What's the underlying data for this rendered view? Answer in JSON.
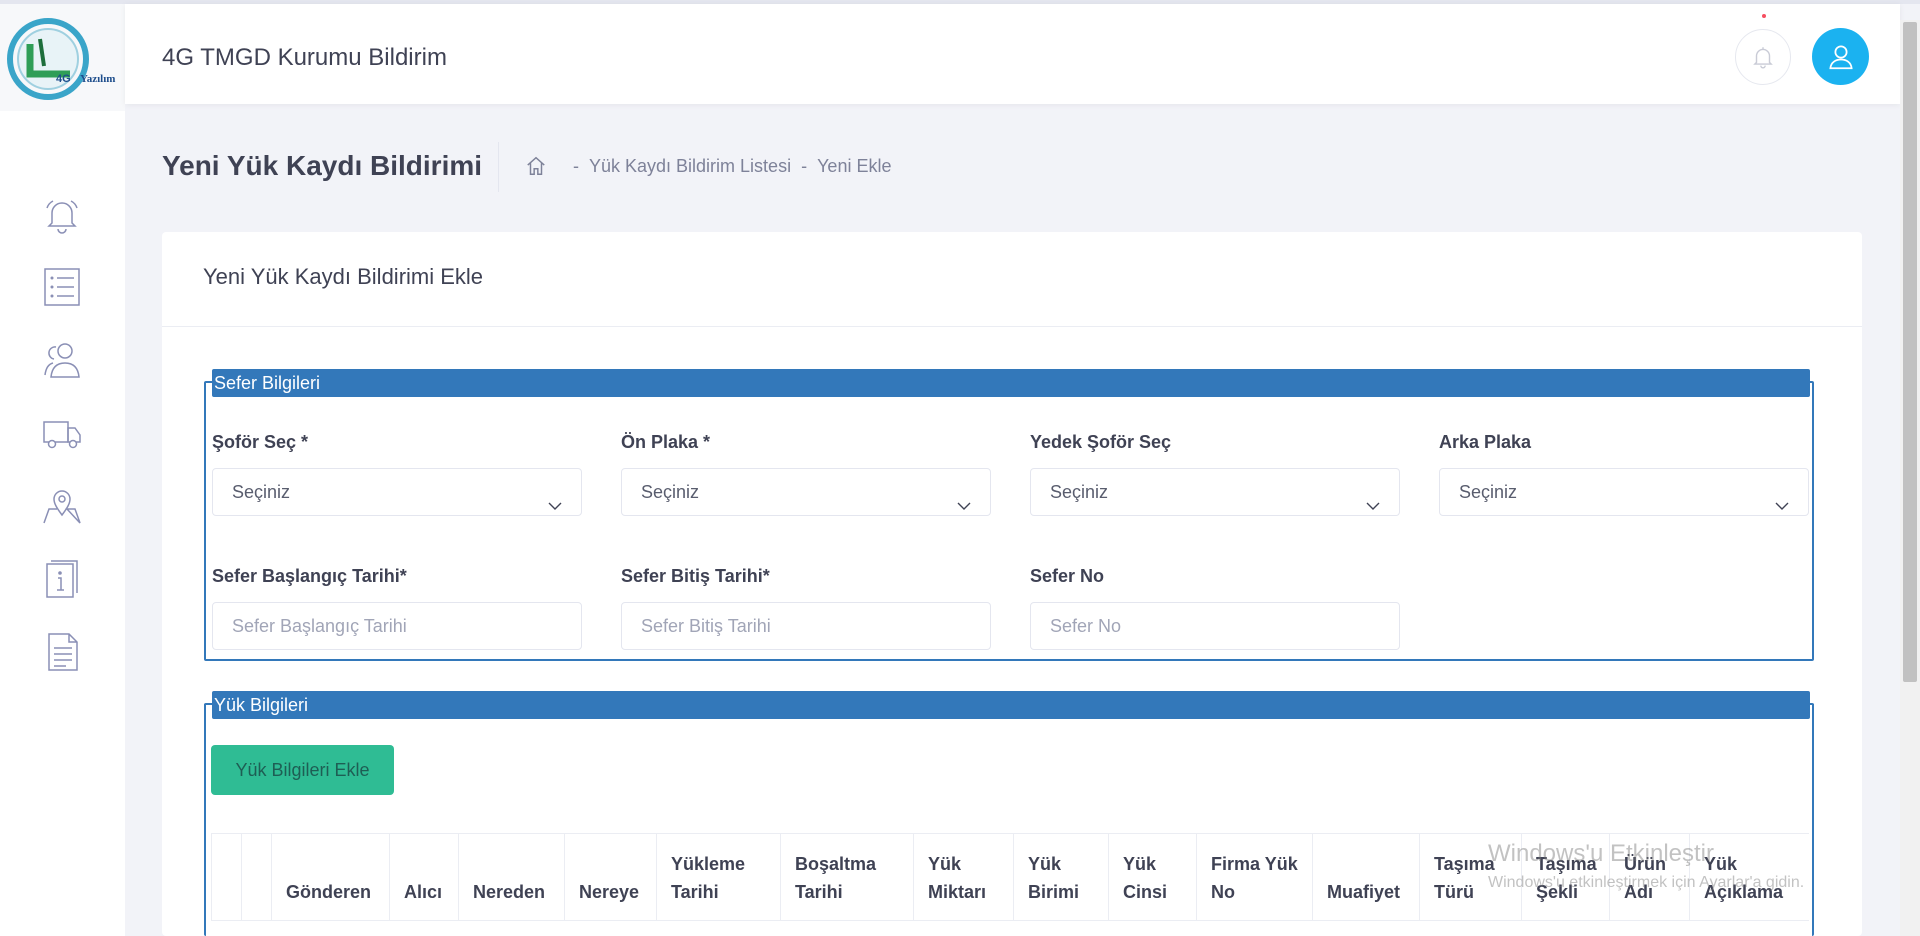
{
  "header": {
    "app_title": "4G TMGD Kurumu Bildirim",
    "logo_text": "4G Yazılım"
  },
  "sidebar": {
    "icons": [
      "bell-icon",
      "list-icon",
      "users-icon",
      "truck-icon",
      "map-pin-icon",
      "info-book-icon",
      "document-icon"
    ]
  },
  "page": {
    "title": "Yeni Yük Kaydı Bildirimi",
    "breadcrumb": [
      "-",
      "Yük Kaydı Bildirim Listesi",
      "-",
      "Yeni Ekle"
    ]
  },
  "card": {
    "title": "Yeni Yük Kaydı Bildirimi Ekle",
    "sefer": {
      "legend": "Sefer Bilgileri",
      "sofor_label": "Şoför Seç *",
      "sofor_value": "Seçiniz",
      "on_plaka_label": "Ön Plaka *",
      "on_plaka_value": "Seçiniz",
      "yedek_sofor_label": "Yedek Şoför Seç",
      "yedek_sofor_value": "Seçiniz",
      "arka_plaka_label": "Arka Plaka",
      "arka_plaka_value": "Seçiniz",
      "baslangic_label": "Sefer Başlangıç Tarihi*",
      "baslangic_placeholder": "Sefer Başlangıç Tarihi",
      "bitis_label": "Sefer Bitiş Tarihi*",
      "bitis_placeholder": "Sefer Bitiş Tarihi",
      "sefer_no_label": "Sefer No",
      "sefer_no_placeholder": "Sefer No"
    },
    "yuk": {
      "legend": "Yük Bilgileri",
      "add_button": "Yük Bilgileri Ekle",
      "columns": [
        "",
        "",
        "Gönderen",
        "Alıcı",
        "Nereden",
        "Nereye",
        "Yükleme Tarihi",
        "Boşaltma Tarihi",
        "Yük Miktarı",
        "Yük Birimi",
        "Yük Cinsi",
        "Firma Yük No",
        "Muafiyet",
        "Taşıma Türü",
        "Taşıma Şekli",
        "Ürün Adı",
        "Yük Açıklama"
      ]
    }
  },
  "watermark": {
    "line1": "Windows'u Etkinleştir",
    "line2": "Windows'u etkinleştirmek için Ayarlar'a gidin."
  },
  "colors": {
    "primary_blue": "#3378ba",
    "accent_cyan": "#1bb2f0",
    "success_green": "#2fbc94"
  }
}
